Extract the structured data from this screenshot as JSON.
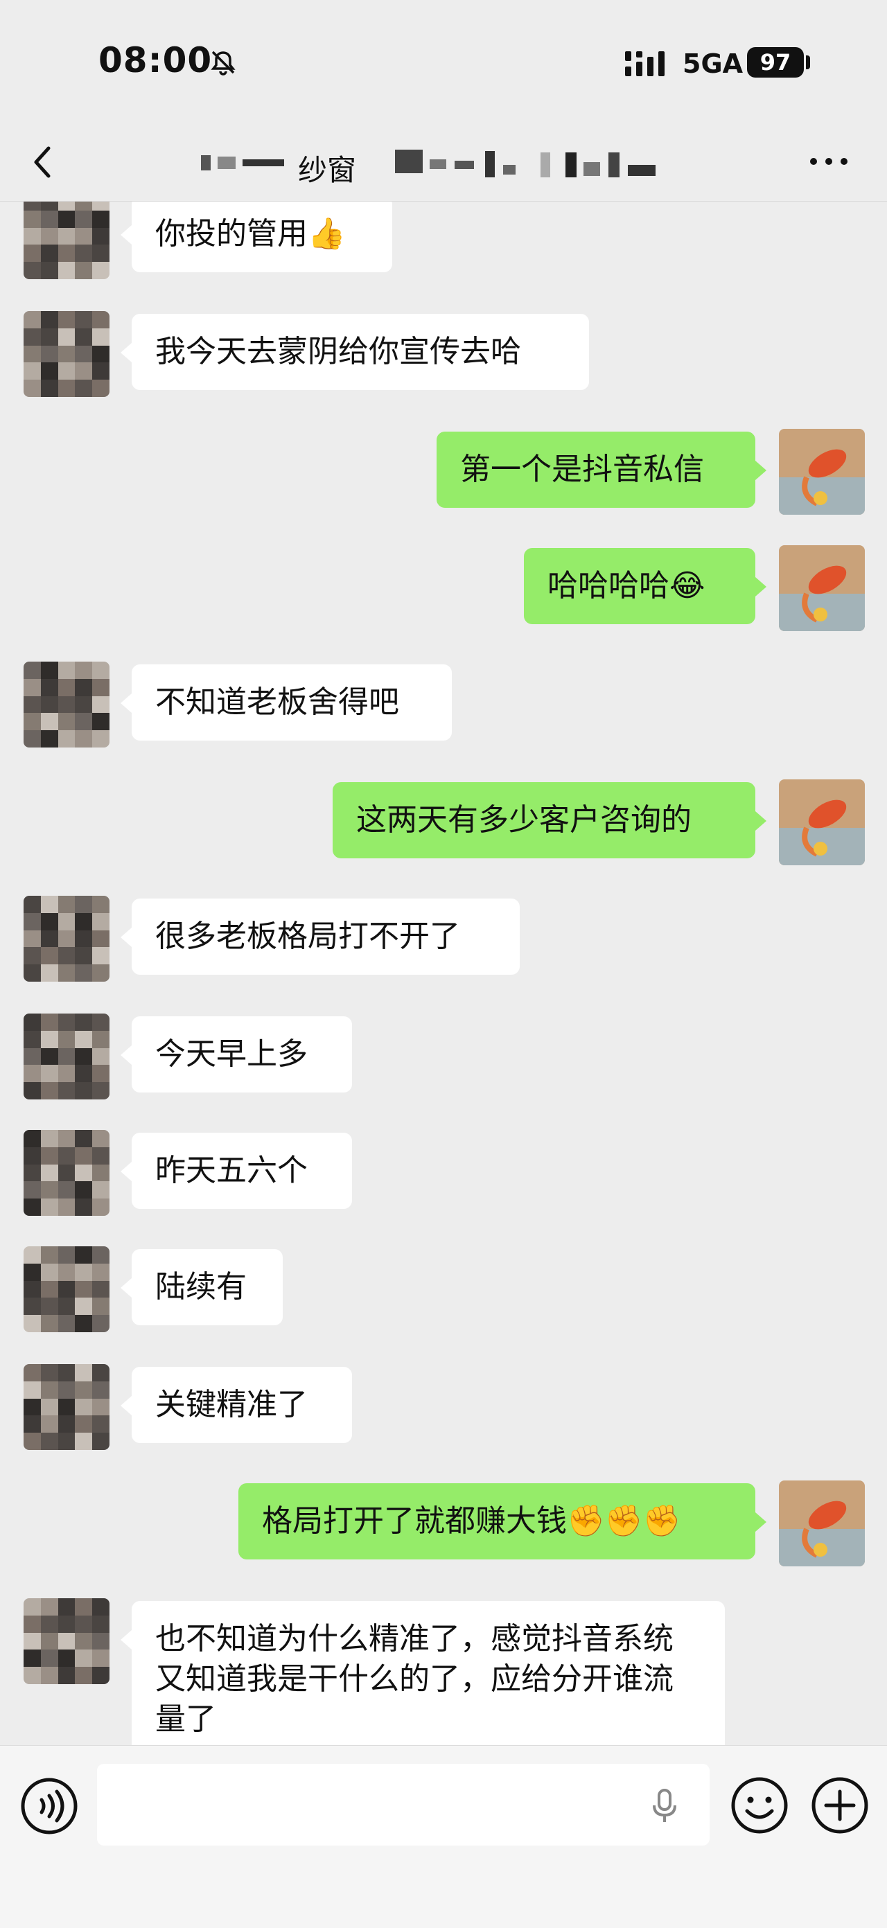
{
  "status_bar": {
    "time": "08:00",
    "network": "5GA",
    "battery": "97",
    "icons": [
      "mute-bell-icon",
      "signal-bars-icon"
    ]
  },
  "header": {
    "title_visible": "纱窗",
    "icons": [
      "back-chevron-icon",
      "more-dots-icon"
    ]
  },
  "colors": {
    "background": "#ededed",
    "incoming_bubble": "#ffffff",
    "outgoing_bubble": "#95ec69"
  },
  "messages": [
    {
      "side": "left",
      "text": "你投的管用👍"
    },
    {
      "side": "left",
      "text": "我今天去蒙阴给你宣传去哈"
    },
    {
      "side": "right",
      "text": "第一个是抖音私信"
    },
    {
      "side": "right",
      "text": "哈哈哈哈😂"
    },
    {
      "side": "left",
      "text": "不知道老板舍得吧"
    },
    {
      "side": "right",
      "text": "这两天有多少客户咨询的"
    },
    {
      "side": "left",
      "text": "很多老板格局打不开了"
    },
    {
      "side": "left",
      "text": "今天早上多"
    },
    {
      "side": "left",
      "text": "昨天五六个"
    },
    {
      "side": "left",
      "text": "陆续有"
    },
    {
      "side": "left",
      "text": "关键精准了"
    },
    {
      "side": "right",
      "text": "格局打开了就都赚大钱✊✊✊"
    },
    {
      "side": "left",
      "text": "也不知道为什么精准了，感觉抖音系统又知道我是干什么的了，应给分开谁流量了"
    }
  ],
  "input_bar": {
    "input_value": "",
    "icons": [
      "voice-icon",
      "mic-icon",
      "emoji-icon",
      "plus-icon"
    ]
  }
}
